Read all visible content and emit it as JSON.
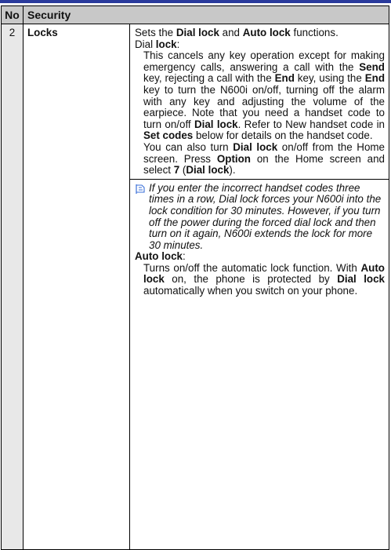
{
  "header": {
    "no": "No",
    "section": "Security"
  },
  "row": {
    "no": "2",
    "name": "Locks",
    "intro_pre": "Sets the ",
    "intro_b1": "Dial lock",
    "intro_mid": " and ",
    "intro_b2": "Auto lock",
    "intro_post": " functions.",
    "dial_heading_pre": "Dial ",
    "dial_heading_b": "lock",
    "dial_heading_post": ":",
    "dial_desc": {
      "p1": "This cancels any key operation except for making emergency calls, answering a call with the ",
      "b1": "Send",
      "p2": " key, rejecting a call with the ",
      "b2": "End",
      "p3": " key, using the ",
      "b3": "End",
      "p4": " key to turn the N600i on/off, turning off the alarm with any key and adjusting the volume of the earpiece. Note that you need a handset code to turn on/off ",
      "b4": "Dial lock",
      "p5": ". Refer to New handset code in ",
      "b5": "Set codes",
      "p6": " below for details on the handset code."
    },
    "home_desc": {
      "p1": "You can also turn ",
      "b1": "Dial lock",
      "p2": " on/off from the Home screen. Press ",
      "b2": "Option",
      "p3": " on the Home screen and select ",
      "b3": "7",
      "p4": " (",
      "b4": "Dial lock",
      "p5": ")."
    },
    "note": "If you enter the incorrect handset codes three times in a row, Dial lock forces your N600i into the lock condition for 30 minutes. However, if you turn off the power during the forced dial lock and then turn on it again, N600i extends the lock for more 30 minutes.",
    "auto_heading_b": "Auto lock",
    "auto_heading_post": ":",
    "auto_desc": {
      "p1": "Turns on/off the automatic lock function. With ",
      "b1": "Auto lock",
      "p2": " on, the phone is protected by ",
      "b2": "Dial lock",
      "p3": " automatically when you switch on your phone."
    }
  },
  "icon": "note-icon",
  "colors": {
    "header_bg": "#c8c8c8",
    "number_col_bg": "#e8e8e8",
    "top_rule": "#2a3a9c",
    "icon": "#3a6fd8"
  }
}
